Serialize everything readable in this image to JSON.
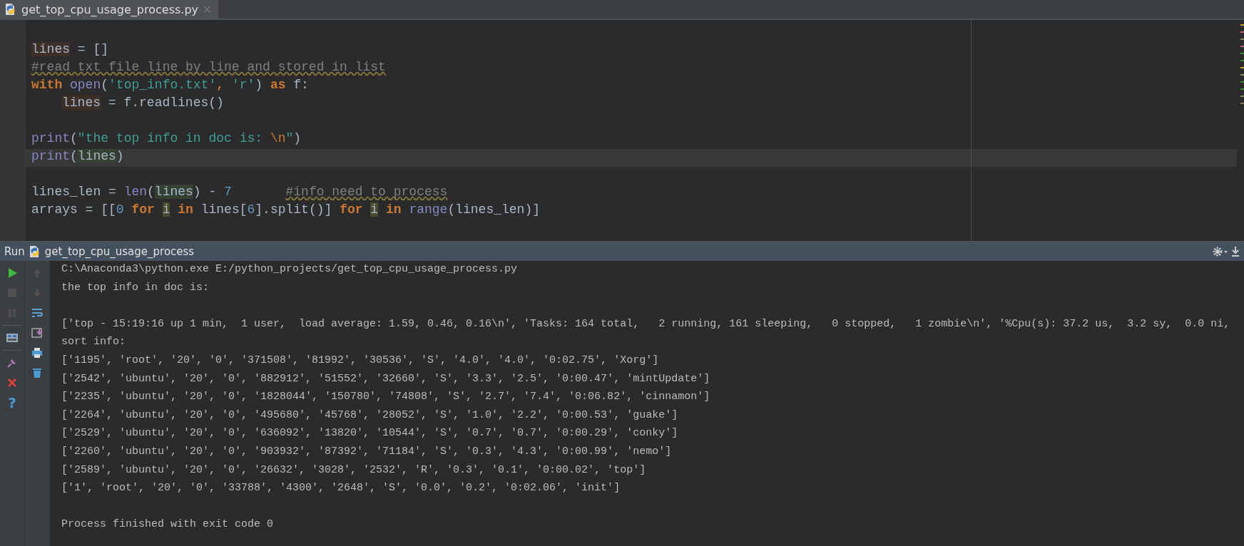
{
  "tabs": [
    {
      "label": "get_top_cpu_usage_process.py",
      "close": "×",
      "selected": true
    }
  ],
  "editor": {
    "lines": [
      {
        "kind": "blank"
      },
      {
        "kind": "code",
        "current": false,
        "segments": [
          {
            "text": "lines",
            "kind": "write"
          },
          {
            "text": " = []",
            "kind": "plain"
          }
        ]
      },
      {
        "kind": "code",
        "current": false,
        "segments": [
          {
            "text": "#read txt file line by line and stored in list",
            "kind": "comment"
          }
        ]
      },
      {
        "kind": "code",
        "current": false,
        "segments": [
          {
            "text": "with ",
            "kind": "keyword"
          },
          {
            "text": "open",
            "kind": "builtin"
          },
          {
            "text": "(",
            "kind": "plain"
          },
          {
            "text": "'top_info.txt'",
            "kind": "string"
          },
          {
            "text": ", ",
            "kind": "keyword"
          },
          {
            "text": "'r'",
            "kind": "string"
          },
          {
            "text": ") ",
            "kind": "plain"
          },
          {
            "text": "as",
            "kind": "keyword"
          },
          {
            "text": " f:",
            "kind": "plain"
          }
        ]
      },
      {
        "kind": "code",
        "current": false,
        "indented": true,
        "segments": [
          {
            "text": "lines",
            "kind": "write"
          },
          {
            "text": " = f.readlines()",
            "kind": "plain"
          }
        ]
      },
      {
        "kind": "blank"
      },
      {
        "kind": "code",
        "current": false,
        "segments": [
          {
            "text": "print",
            "kind": "builtin"
          },
          {
            "text": "(",
            "kind": "plain"
          },
          {
            "text": "\"the top info in doc is: ",
            "kind": "string"
          },
          {
            "text": "\\n",
            "kind": "escape"
          },
          {
            "text": "\"",
            "kind": "string"
          },
          {
            "text": ")",
            "kind": "plain"
          }
        ]
      },
      {
        "kind": "code",
        "current": true,
        "segments": [
          {
            "text": "print",
            "kind": "builtin"
          },
          {
            "text": "(",
            "kind": "plain"
          },
          {
            "text": "lines",
            "kind": "read"
          },
          {
            "text": ")",
            "kind": "plain"
          }
        ]
      },
      {
        "kind": "blank"
      },
      {
        "kind": "code",
        "current": false,
        "segments": [
          {
            "text": "lines_len = ",
            "kind": "plain"
          },
          {
            "text": "len",
            "kind": "builtin"
          },
          {
            "text": "(",
            "kind": "plain"
          },
          {
            "text": "lines",
            "kind": "read"
          },
          {
            "text": ") - ",
            "kind": "plain"
          },
          {
            "text": "7       ",
            "kind": "number"
          },
          {
            "text": "#info need to process",
            "kind": "comment"
          }
        ]
      },
      {
        "kind": "code",
        "current": false,
        "segments": [
          {
            "text": "arrays = [[",
            "kind": "plain"
          },
          {
            "text": "0 ",
            "kind": "number"
          },
          {
            "text": "for ",
            "kind": "keyword"
          },
          {
            "text": "i",
            "kind": "unused"
          },
          {
            "text": " in",
            "kind": "keyword"
          },
          {
            "text": " lines[",
            "kind": "plain"
          },
          {
            "text": "6",
            "kind": "number"
          },
          {
            "text": "].split()] ",
            "kind": "plain"
          },
          {
            "text": "for ",
            "kind": "keyword"
          },
          {
            "text": "i",
            "kind": "unused"
          },
          {
            "text": " in ",
            "kind": "keyword"
          },
          {
            "text": "range",
            "kind": "builtin"
          },
          {
            "text": "(lines_len)]",
            "kind": "plain"
          }
        ]
      }
    ],
    "stripe_marks": [
      {
        "color": "#c9a227"
      },
      {
        "color": "#c05c7e"
      },
      {
        "color": "#8a8a5a"
      },
      {
        "color": "#c05c7e"
      },
      {
        "color": "#2e8b2e"
      },
      {
        "color": "#2e8b2e"
      },
      {
        "color": "#c9a227"
      },
      {
        "color": "#8a8a5a"
      },
      {
        "color": "#2e8b2e"
      },
      {
        "color": "#2e8b2e"
      },
      {
        "color": "#8a8a5a"
      },
      {
        "color": "#8a7a5a"
      }
    ]
  },
  "run_panel": {
    "label": "Run",
    "config": "get_top_cpu_usage_process",
    "tools_left": [
      {
        "kind": "run",
        "disabled": false
      },
      {
        "kind": "stop",
        "disabled": true
      },
      {
        "kind": "pause",
        "disabled": true
      },
      {
        "kind": "separator"
      },
      {
        "kind": "layout",
        "disabled": false
      },
      {
        "kind": "separator"
      },
      {
        "kind": "pin",
        "disabled": false
      },
      {
        "kind": "close",
        "disabled": false
      },
      {
        "kind": "help",
        "label": "?",
        "disabled": false
      }
    ],
    "tools_right": [
      {
        "kind": "up",
        "disabled": true
      },
      {
        "kind": "down",
        "disabled": true
      },
      {
        "kind": "wrap",
        "disabled": false
      },
      {
        "kind": "scroll_end",
        "disabled": false
      },
      {
        "kind": "print",
        "disabled": false
      },
      {
        "kind": "trash",
        "disabled": false
      }
    ],
    "console": [
      {
        "kind": "text",
        "text": "C:\\Anaconda3\\python.exe E:/python_projects/get_top_cpu_usage_process.py"
      },
      {
        "kind": "text",
        "text": "the top info in doc is:"
      },
      {
        "kind": "blank"
      },
      {
        "kind": "text",
        "text": "['top - 15:19:16 up 1 min,  1 user,  load average: 1.59, 0.46, 0.16\\n', 'Tasks: 164 total,   2 running, 161 sleeping,   0 stopped,   1 zombie\\n', '%Cpu(s): 37.2 us,  3.2 sy,  0.0 ni,"
      },
      {
        "kind": "text",
        "text": "sort info:"
      },
      {
        "kind": "text",
        "text": "['1195', 'root', '20', '0', '371508', '81992', '30536', 'S', '4.0', '4.0', '0:02.75', 'Xorg']"
      },
      {
        "kind": "text",
        "text": "['2542', 'ubuntu', '20', '0', '882912', '51552', '32660', 'S', '3.3', '2.5', '0:00.47', 'mintUpdate']"
      },
      {
        "kind": "text",
        "text": "['2235', 'ubuntu', '20', '0', '1828044', '150780', '74808', 'S', '2.7', '7.4', '0:06.82', 'cinnamon']"
      },
      {
        "kind": "text",
        "text": "['2264', 'ubuntu', '20', '0', '495680', '45768', '28052', 'S', '1.0', '2.2', '0:00.53', 'guake']"
      },
      {
        "kind": "text",
        "text": "['2529', 'ubuntu', '20', '0', '636092', '13820', '10544', 'S', '0.7', '0.7', '0:00.29', 'conky']"
      },
      {
        "kind": "text",
        "text": "['2260', 'ubuntu', '20', '0', '903932', '87392', '71184', 'S', '0.3', '4.3', '0:00.99', 'nemo']"
      },
      {
        "kind": "text",
        "text": "['2589', 'ubuntu', '20', '0', '26632', '3028', '2532', 'R', '0.3', '0.1', '0:00.02', 'top']"
      },
      {
        "kind": "text",
        "text": "['1', 'root', '20', '0', '33788', '4300', '2648', 'S', '0.0', '0.2', '0:02.06', 'init']"
      },
      {
        "kind": "blank"
      },
      {
        "kind": "text",
        "text": "Process finished with exit code 0"
      }
    ]
  }
}
